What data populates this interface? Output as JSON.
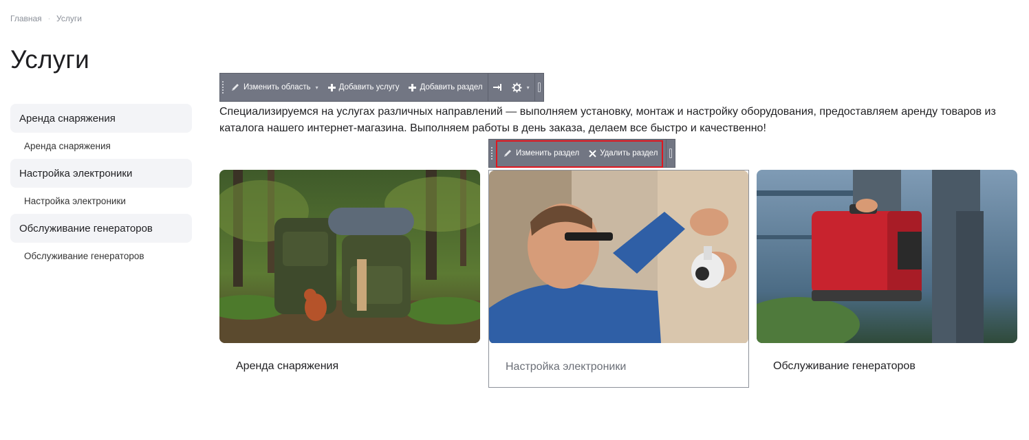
{
  "breadcrumb": {
    "home": "Главная",
    "separator": "·",
    "current": "Услуги"
  },
  "page": {
    "title": "Услуги"
  },
  "sidebar": {
    "items": [
      {
        "section": "Аренда снаряжения",
        "sub": "Аренда снаряжения"
      },
      {
        "section": "Настройка электроники",
        "sub": "Настройка электроники"
      },
      {
        "section": "Обслуживание генераторов",
        "sub": "Обслуживание генераторов"
      }
    ]
  },
  "area_toolbar": {
    "edit_area": "Изменить область",
    "add_service": "Добавить услугу",
    "add_section": "Добавить раздел"
  },
  "section_toolbar": {
    "edit_section": "Изменить раздел",
    "delete_section": "Удалить раздел"
  },
  "intro": "Специализируемся на услугах различных направлений — выполняем установку, монтаж и настройку оборудования, предоставляем аренду товаров из каталога нашего интернет-магазина. Выполняем работы в день заказа, делаем все быстро и качественно!",
  "cards": [
    {
      "title": "Аренда снаряжения"
    },
    {
      "title": "Настройка электроники"
    },
    {
      "title": "Обслуживание генераторов"
    }
  ],
  "colors": {
    "toolbar_bg": "#727683",
    "highlight": "#e0161e",
    "sidebar_bg": "#f3f4f7"
  }
}
